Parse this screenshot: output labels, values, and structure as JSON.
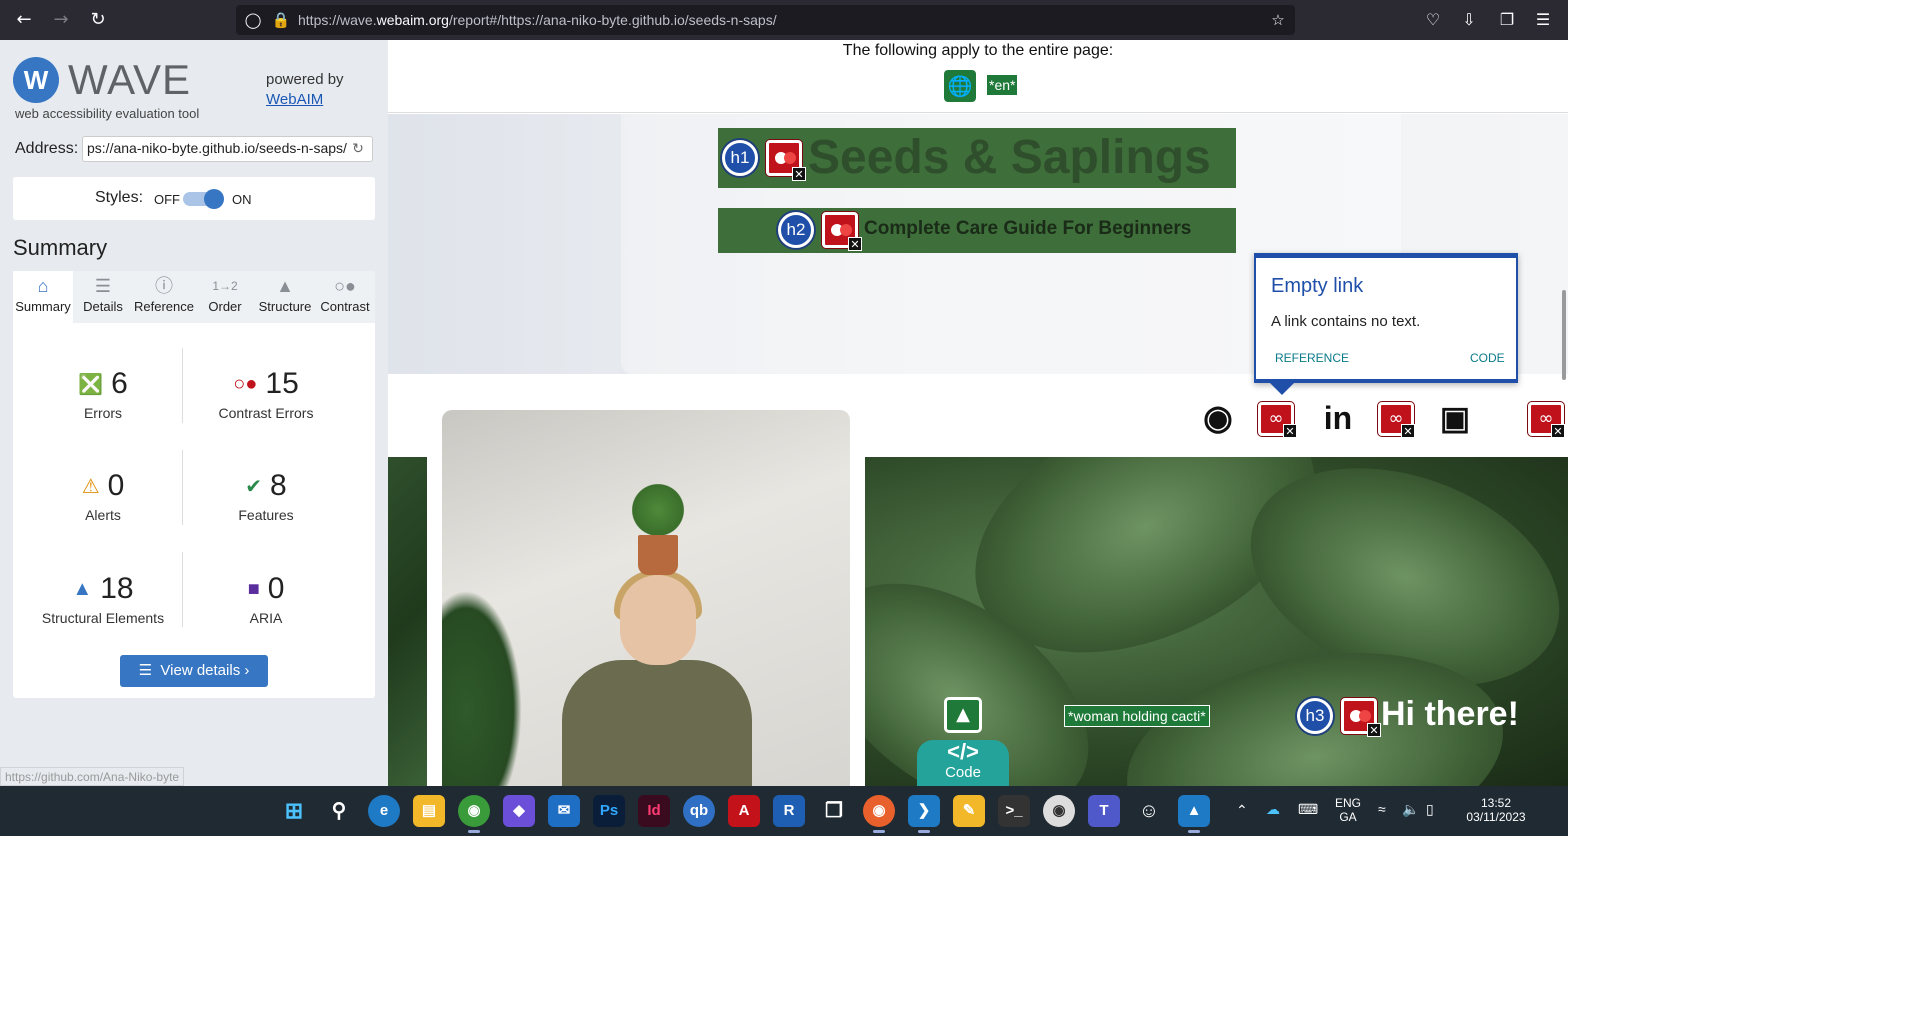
{
  "browser": {
    "url_prefix": "https://wave.",
    "url_domain": "webaim.org",
    "url_rest": "/report#/https://ana-niko-byte.github.io/seeds-n-saps/",
    "icons": [
      "back-icon",
      "forward-icon",
      "reload-icon",
      "shield-icon",
      "lock-icon",
      "star-icon",
      "pocket-icon",
      "download-icon",
      "extensions-icon",
      "menu-icon"
    ]
  },
  "wave": {
    "logo_letter": "W",
    "logo_text": "WAVE",
    "logo_sub": "web accessibility evaluation tool",
    "powered_by": "powered by",
    "webaim_link": "WebAIM",
    "address_label": "Address:",
    "address_value": "ps://ana-niko-byte.github.io/seeds-n-saps/",
    "styles_label": "Styles:",
    "styles_off": "OFF",
    "styles_on": "ON",
    "styles_enabled": true,
    "summary_heading": "Summary",
    "tabs": [
      {
        "label": "Summary",
        "icon": "home-icon",
        "active": true
      },
      {
        "label": "Details",
        "icon": "list-icon",
        "active": false
      },
      {
        "label": "Reference",
        "icon": "info-icon",
        "active": false
      },
      {
        "label": "Order",
        "icon": "order-icon",
        "active": false
      },
      {
        "label": "Structure",
        "icon": "structure-icon",
        "active": false
      },
      {
        "label": "Contrast",
        "icon": "contrast-icon",
        "active": false
      }
    ],
    "stats": {
      "errors": {
        "value": "6",
        "label": "Errors"
      },
      "contrast": {
        "value": "15",
        "label": "Contrast Errors"
      },
      "alerts": {
        "value": "0",
        "label": "Alerts"
      },
      "features": {
        "value": "8",
        "label": "Features"
      },
      "structural": {
        "value": "18",
        "label": "Structural Elements"
      },
      "aria": {
        "value": "0",
        "label": "ARIA"
      }
    },
    "view_details": "View details ›",
    "status_url": "https://github.com/Ana-Niko-byte"
  },
  "page": {
    "apply_text": "The following apply to the entire page:",
    "lang_badge": "*en*",
    "h1_badge": "h1",
    "h1_text": "Seeds & Saplings",
    "h2_badge": "h2",
    "h2_text": "Complete Care Guide For Beginners",
    "h3_badge": "h3",
    "h3_text": "Hi there!",
    "alt_badge": "*woman holding cacti*",
    "code_label": "Code",
    "code_icon": "</>",
    "tooltip": {
      "title": "Empty link",
      "description": "A link contains no text.",
      "reference": "REFERENCE",
      "code": "CODE"
    },
    "social_icons": [
      "github-icon",
      "linkedin-icon",
      "instagram-icon"
    ]
  },
  "taskbar": {
    "lang_top": "ENG",
    "lang_bottom": "GA",
    "time": "13:52",
    "date": "03/11/2023"
  },
  "colors": {
    "wave_blue": "#3776c3",
    "error_red": "#c0121b",
    "feature_green": "#1f7a3a",
    "heading_bar": "#3e6e3a"
  }
}
